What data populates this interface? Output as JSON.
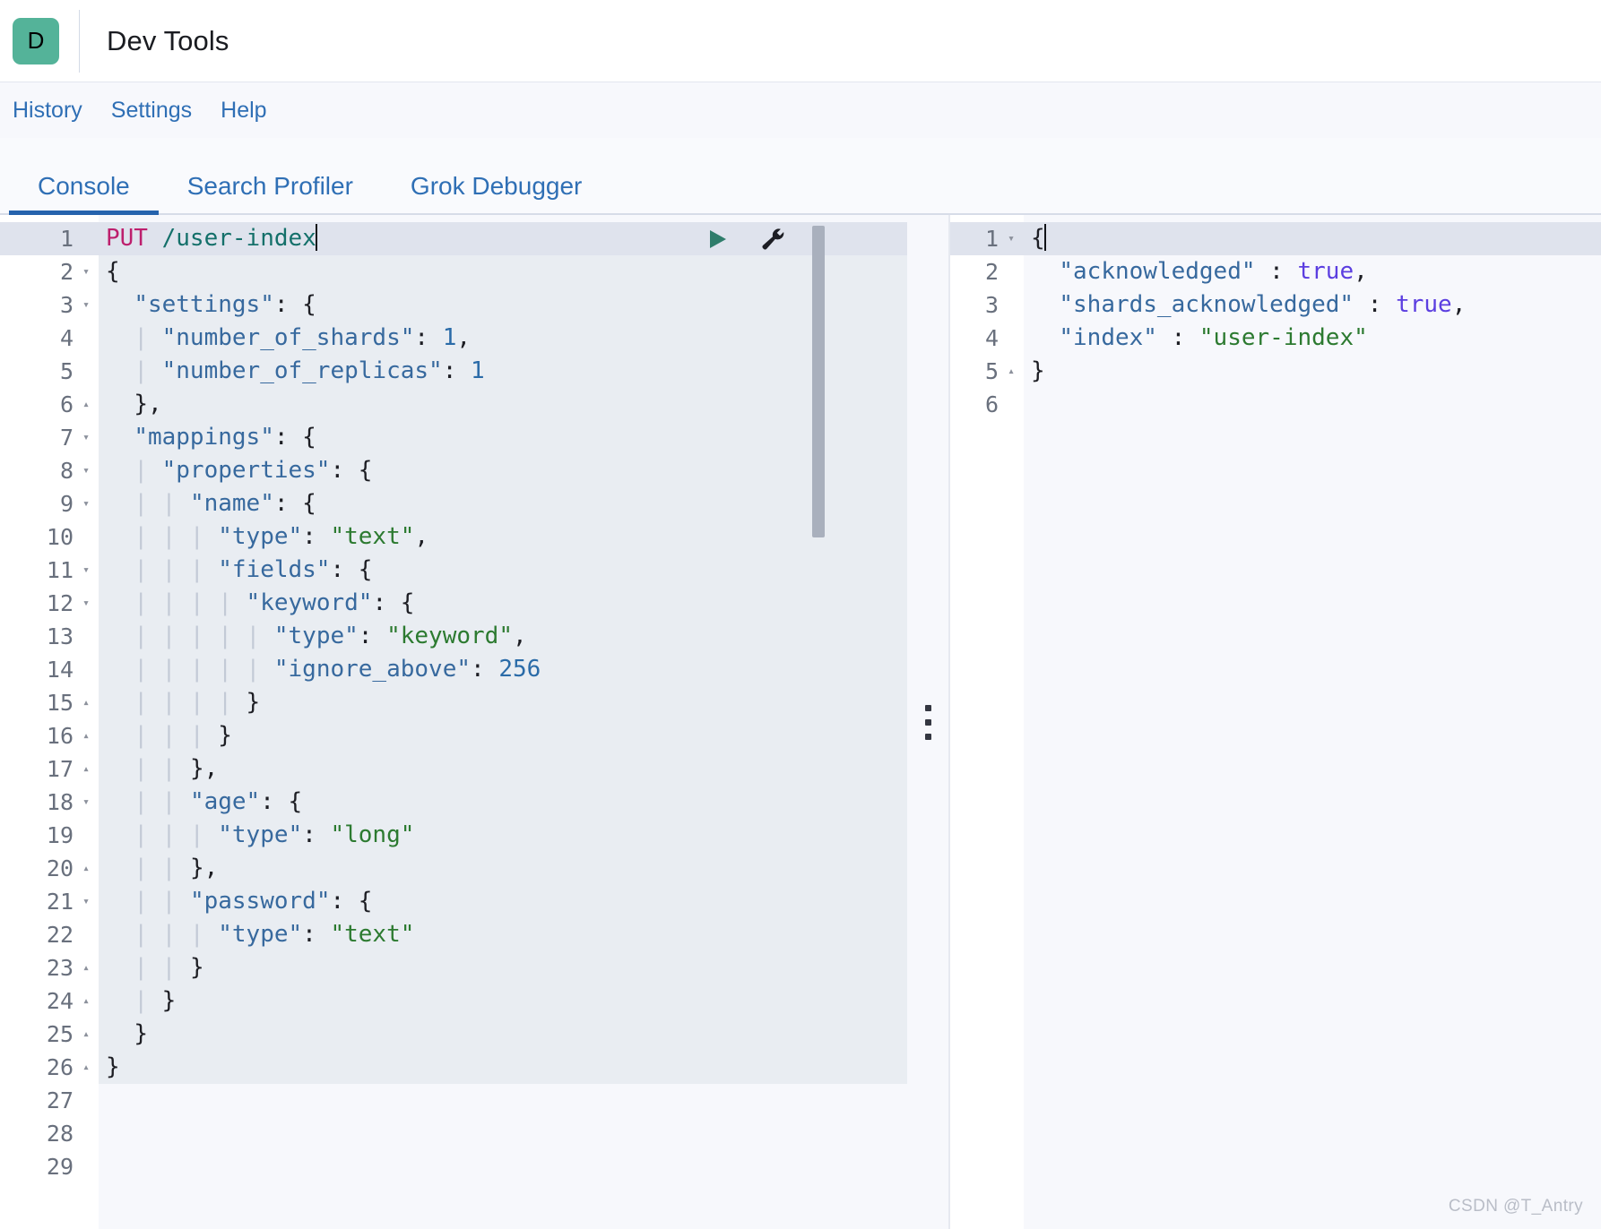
{
  "header": {
    "logo_letter": "D",
    "logo_color": "#54b399",
    "title": "Dev Tools"
  },
  "nav": {
    "links": [
      {
        "label": "History"
      },
      {
        "label": "Settings"
      },
      {
        "label": "Help"
      }
    ]
  },
  "tabs": {
    "active": "Console",
    "items": [
      {
        "label": "Console",
        "active": true
      },
      {
        "label": "Search Profiler",
        "active": false
      },
      {
        "label": "Grok Debugger",
        "active": false
      }
    ]
  },
  "toolbar": {
    "play_icon": "play-icon",
    "wrench_icon": "wrench-icon",
    "accent_color": "#2f7d6b"
  },
  "request_editor": {
    "total_lines": 29,
    "lines": [
      {
        "n": 1,
        "fold": "none",
        "highlight": true,
        "tokens": [
          {
            "t": "PUT",
            "c": "method"
          },
          {
            "t": " ",
            "c": "plain"
          },
          {
            "t": "/user-index",
            "c": "url"
          }
        ],
        "caret": true
      },
      {
        "n": 2,
        "fold": "down",
        "tokens": [
          {
            "t": "{",
            "c": "punc"
          }
        ]
      },
      {
        "n": 3,
        "fold": "down",
        "tokens": [
          {
            "t": "  ",
            "c": "plain"
          },
          {
            "t": "\"settings\"",
            "c": "key"
          },
          {
            "t": ": {",
            "c": "punc"
          }
        ]
      },
      {
        "n": 4,
        "fold": "none",
        "tokens": [
          {
            "t": "  ",
            "c": "plain"
          },
          {
            "t": "| ",
            "c": "guide"
          },
          {
            "t": "\"number_of_shards\"",
            "c": "key"
          },
          {
            "t": ": ",
            "c": "punc"
          },
          {
            "t": "1",
            "c": "num"
          },
          {
            "t": ",",
            "c": "punc"
          }
        ]
      },
      {
        "n": 5,
        "fold": "none",
        "tokens": [
          {
            "t": "  ",
            "c": "plain"
          },
          {
            "t": "| ",
            "c": "guide"
          },
          {
            "t": "\"number_of_replicas\"",
            "c": "key"
          },
          {
            "t": ": ",
            "c": "punc"
          },
          {
            "t": "1",
            "c": "num"
          }
        ]
      },
      {
        "n": 6,
        "fold": "up",
        "tokens": [
          {
            "t": "  ",
            "c": "plain"
          },
          {
            "t": "},",
            "c": "punc"
          }
        ]
      },
      {
        "n": 7,
        "fold": "down",
        "tokens": [
          {
            "t": "  ",
            "c": "plain"
          },
          {
            "t": "\"mappings\"",
            "c": "key"
          },
          {
            "t": ": {",
            "c": "punc"
          }
        ]
      },
      {
        "n": 8,
        "fold": "down",
        "tokens": [
          {
            "t": "  ",
            "c": "plain"
          },
          {
            "t": "| ",
            "c": "guide"
          },
          {
            "t": "\"properties\"",
            "c": "key"
          },
          {
            "t": ": {",
            "c": "punc"
          }
        ]
      },
      {
        "n": 9,
        "fold": "down",
        "tokens": [
          {
            "t": "  ",
            "c": "plain"
          },
          {
            "t": "| | ",
            "c": "guide"
          },
          {
            "t": "\"name\"",
            "c": "key"
          },
          {
            "t": ": {",
            "c": "punc"
          }
        ]
      },
      {
        "n": 10,
        "fold": "none",
        "tokens": [
          {
            "t": "  ",
            "c": "plain"
          },
          {
            "t": "| | | ",
            "c": "guide"
          },
          {
            "t": "\"type\"",
            "c": "key"
          },
          {
            "t": ": ",
            "c": "punc"
          },
          {
            "t": "\"text\"",
            "c": "str"
          },
          {
            "t": ",",
            "c": "punc"
          }
        ]
      },
      {
        "n": 11,
        "fold": "down",
        "tokens": [
          {
            "t": "  ",
            "c": "plain"
          },
          {
            "t": "| | | ",
            "c": "guide"
          },
          {
            "t": "\"fields\"",
            "c": "key"
          },
          {
            "t": ": {",
            "c": "punc"
          }
        ]
      },
      {
        "n": 12,
        "fold": "down",
        "tokens": [
          {
            "t": "  ",
            "c": "plain"
          },
          {
            "t": "| | | | ",
            "c": "guide"
          },
          {
            "t": "\"keyword\"",
            "c": "key"
          },
          {
            "t": ": {",
            "c": "punc"
          }
        ]
      },
      {
        "n": 13,
        "fold": "none",
        "tokens": [
          {
            "t": "  ",
            "c": "plain"
          },
          {
            "t": "| | | | | ",
            "c": "guide"
          },
          {
            "t": "\"type\"",
            "c": "key"
          },
          {
            "t": ": ",
            "c": "punc"
          },
          {
            "t": "\"keyword\"",
            "c": "str"
          },
          {
            "t": ",",
            "c": "punc"
          }
        ]
      },
      {
        "n": 14,
        "fold": "none",
        "tokens": [
          {
            "t": "  ",
            "c": "plain"
          },
          {
            "t": "| | | | | ",
            "c": "guide"
          },
          {
            "t": "\"ignore_above\"",
            "c": "key"
          },
          {
            "t": ": ",
            "c": "punc"
          },
          {
            "t": "256",
            "c": "num"
          }
        ]
      },
      {
        "n": 15,
        "fold": "up",
        "tokens": [
          {
            "t": "  ",
            "c": "plain"
          },
          {
            "t": "| | | | ",
            "c": "guide"
          },
          {
            "t": "}",
            "c": "punc"
          }
        ]
      },
      {
        "n": 16,
        "fold": "up",
        "tokens": [
          {
            "t": "  ",
            "c": "plain"
          },
          {
            "t": "| | | ",
            "c": "guide"
          },
          {
            "t": "}",
            "c": "punc"
          }
        ]
      },
      {
        "n": 17,
        "fold": "up",
        "tokens": [
          {
            "t": "  ",
            "c": "plain"
          },
          {
            "t": "| | ",
            "c": "guide"
          },
          {
            "t": "},",
            "c": "punc"
          }
        ]
      },
      {
        "n": 18,
        "fold": "down",
        "tokens": [
          {
            "t": "  ",
            "c": "plain"
          },
          {
            "t": "| | ",
            "c": "guide"
          },
          {
            "t": "\"age\"",
            "c": "key"
          },
          {
            "t": ": {",
            "c": "punc"
          }
        ]
      },
      {
        "n": 19,
        "fold": "none",
        "tokens": [
          {
            "t": "  ",
            "c": "plain"
          },
          {
            "t": "| | | ",
            "c": "guide"
          },
          {
            "t": "\"type\"",
            "c": "key"
          },
          {
            "t": ": ",
            "c": "punc"
          },
          {
            "t": "\"long\"",
            "c": "str"
          }
        ]
      },
      {
        "n": 20,
        "fold": "up",
        "tokens": [
          {
            "t": "  ",
            "c": "plain"
          },
          {
            "t": "| | ",
            "c": "guide"
          },
          {
            "t": "},",
            "c": "punc"
          }
        ]
      },
      {
        "n": 21,
        "fold": "down",
        "tokens": [
          {
            "t": "  ",
            "c": "plain"
          },
          {
            "t": "| | ",
            "c": "guide"
          },
          {
            "t": "\"password\"",
            "c": "key"
          },
          {
            "t": ": {",
            "c": "punc"
          }
        ]
      },
      {
        "n": 22,
        "fold": "none",
        "tokens": [
          {
            "t": "  ",
            "c": "plain"
          },
          {
            "t": "| | | ",
            "c": "guide"
          },
          {
            "t": "\"type\"",
            "c": "key"
          },
          {
            "t": ": ",
            "c": "punc"
          },
          {
            "t": "\"text\"",
            "c": "str"
          }
        ]
      },
      {
        "n": 23,
        "fold": "up",
        "tokens": [
          {
            "t": "  ",
            "c": "plain"
          },
          {
            "t": "| | ",
            "c": "guide"
          },
          {
            "t": "}",
            "c": "punc"
          }
        ]
      },
      {
        "n": 24,
        "fold": "up",
        "tokens": [
          {
            "t": "  ",
            "c": "plain"
          },
          {
            "t": "| ",
            "c": "guide"
          },
          {
            "t": "}",
            "c": "punc"
          }
        ]
      },
      {
        "n": 25,
        "fold": "up",
        "tokens": [
          {
            "t": "  ",
            "c": "plain"
          },
          {
            "t": "}",
            "c": "punc"
          }
        ]
      },
      {
        "n": 26,
        "fold": "up",
        "tokens": [
          {
            "t": "}",
            "c": "punc"
          }
        ]
      },
      {
        "n": 27,
        "fold": "none",
        "tokens": []
      },
      {
        "n": 28,
        "fold": "none",
        "tokens": []
      },
      {
        "n": 29,
        "fold": "none",
        "tokens": []
      }
    ]
  },
  "response_editor": {
    "total_lines": 6,
    "lines": [
      {
        "n": 1,
        "fold": "down",
        "highlight": true,
        "tokens": [
          {
            "t": "{",
            "c": "punc"
          }
        ],
        "caret": true
      },
      {
        "n": 2,
        "fold": "none",
        "tokens": [
          {
            "t": "  ",
            "c": "plain"
          },
          {
            "t": "\"acknowledged\"",
            "c": "key"
          },
          {
            "t": " : ",
            "c": "punc"
          },
          {
            "t": "true",
            "c": "bool"
          },
          {
            "t": ",",
            "c": "punc"
          }
        ]
      },
      {
        "n": 3,
        "fold": "none",
        "tokens": [
          {
            "t": "  ",
            "c": "plain"
          },
          {
            "t": "\"shards_acknowledged\"",
            "c": "key"
          },
          {
            "t": " : ",
            "c": "punc"
          },
          {
            "t": "true",
            "c": "bool"
          },
          {
            "t": ",",
            "c": "punc"
          }
        ]
      },
      {
        "n": 4,
        "fold": "none",
        "tokens": [
          {
            "t": "  ",
            "c": "plain"
          },
          {
            "t": "\"index\"",
            "c": "key"
          },
          {
            "t": " : ",
            "c": "punc"
          },
          {
            "t": "\"user-index\"",
            "c": "str"
          }
        ]
      },
      {
        "n": 5,
        "fold": "up",
        "tokens": [
          {
            "t": "}",
            "c": "punc"
          }
        ]
      },
      {
        "n": 6,
        "fold": "none",
        "tokens": []
      }
    ]
  },
  "splitter": {
    "handle_icon": "drag-dots-icon"
  },
  "watermark": {
    "text": "CSDN @T_Antry"
  }
}
